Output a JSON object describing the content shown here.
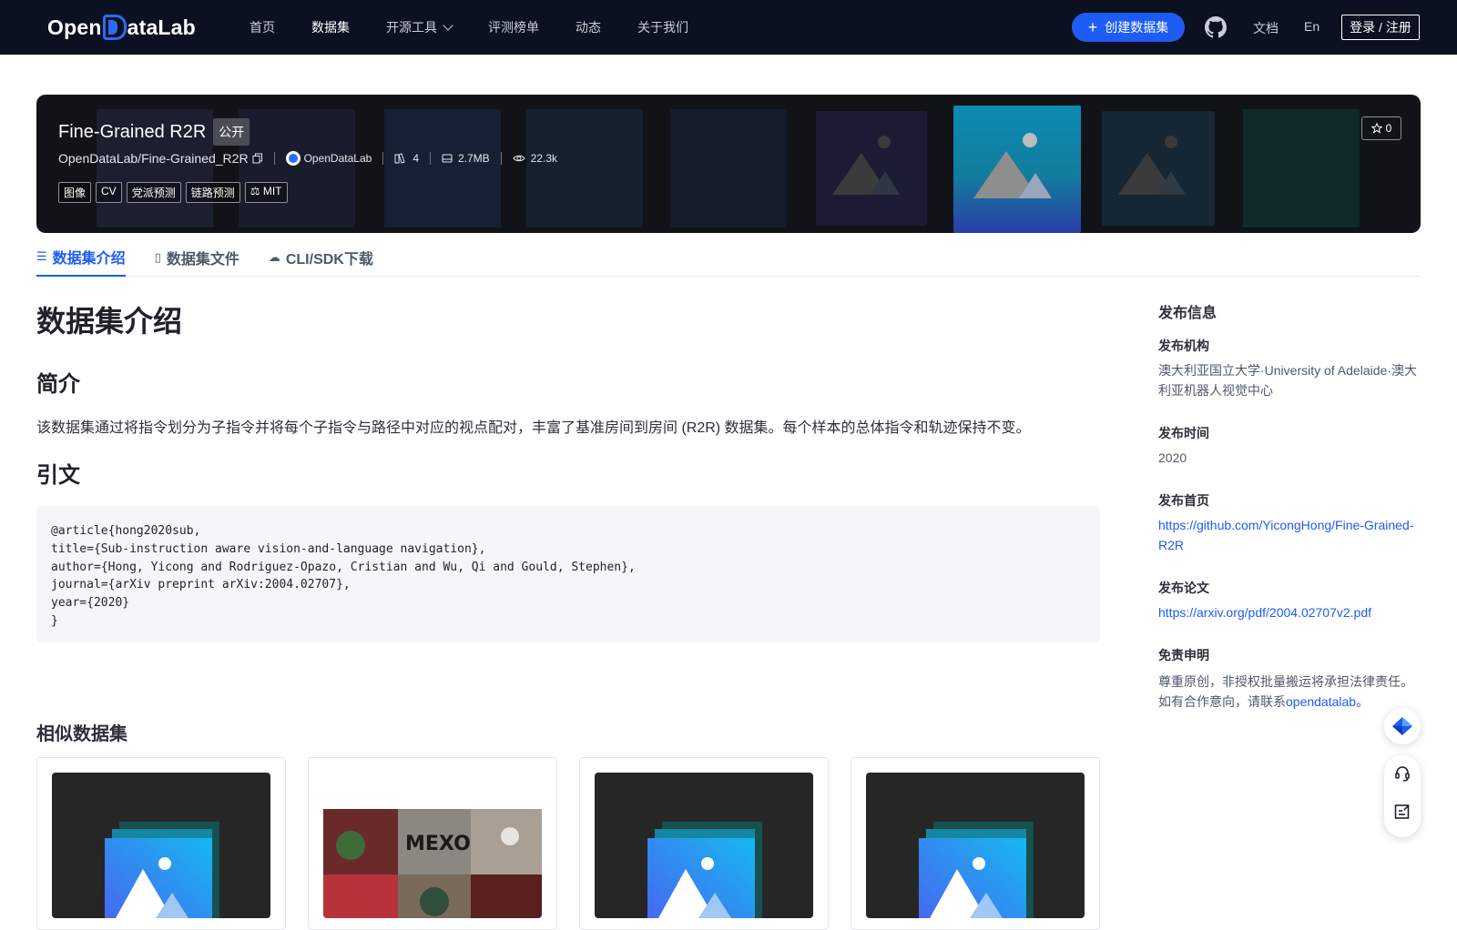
{
  "nav": {
    "logo": {
      "left": "Open",
      "right": "ataLab"
    },
    "items": [
      {
        "label": "首页",
        "active": false
      },
      {
        "label": "数据集",
        "active": true
      },
      {
        "label": "开源工具",
        "active": false,
        "dropdown": true
      },
      {
        "label": "评测榜单",
        "active": false
      },
      {
        "label": "动态",
        "active": false
      },
      {
        "label": "关于我们",
        "active": false
      }
    ],
    "create_label": "创建数据集",
    "docs_label": "文档",
    "lang_label": "En",
    "login_label": "登录 / 注册",
    "icons": {
      "github": "github-icon",
      "create": "plus-icon"
    }
  },
  "banner": {
    "title": "Fine-Grained R2R",
    "visibility": "公开",
    "repo": "OpenDataLab/Fine-Grained_R2R",
    "publisher": "OpenDataLab",
    "file_count": "4",
    "size": "2.7MB",
    "views": "22.3k",
    "tags": [
      "图像",
      "CV",
      "党派预测",
      "链路预测",
      "MIT"
    ],
    "star_count": "0"
  },
  "tabs": [
    {
      "label": "数据集介绍",
      "icon": "database-icon",
      "active": true
    },
    {
      "label": "数据集文件",
      "icon": "file-icon",
      "active": false
    },
    {
      "label": "CLI/SDK下载",
      "icon": "cloud-download-icon",
      "active": false
    }
  ],
  "main": {
    "heading": "数据集介绍",
    "intro_heading": "简介",
    "intro_text": "该数据集通过将指令划分为子指令并将每个子指令与路径中对应的视点配对，丰富了基准房间到房间 (R2R) 数据集。每个样本的总体指令和轨迹保持不变。",
    "citation_heading": "引文",
    "citation": "@article{hong2020sub,\ntitle={Sub-instruction aware vision-and-language navigation},\nauthor={Hong, Yicong and Rodriguez-Opazo, Cristian and Wu, Qi and Gould, Stephen},\njournal={arXiv preprint arXiv:2004.02707},\nyear={2020}\n}",
    "similar_heading": "相似数据集"
  },
  "sidebar": {
    "title": "发布信息",
    "org_label": "发布机构",
    "org_value": "澳大利亚国立大学·University of Adelaide·澳大利亚机器人视觉中心",
    "time_label": "发布时间",
    "time_value": "2020",
    "homepage_label": "发布首页",
    "homepage_value": "https://github.com/YicongHong/Fine-Grained-R2R",
    "paper_label": "发布论文",
    "paper_value": "https://arxiv.org/pdf/2004.02707v2.pdf",
    "disclaimer_label": "免责申明",
    "disclaimer_text_1": "尊重原创，非授权批量搬运将承担法律责任。如有合作意向，请联系",
    "disclaimer_link": "opendatalab",
    "disclaimer_text_2": "。"
  },
  "colors": {
    "nav_bg": "#0b1120",
    "accent": "#1d5cf5",
    "banner_bg": "#111318"
  }
}
